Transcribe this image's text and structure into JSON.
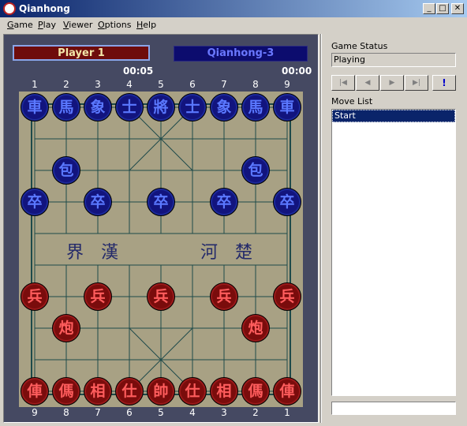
{
  "window": {
    "title": "Qianhong",
    "minimize": "_",
    "maximize": "□",
    "close": "✕"
  },
  "menu": [
    "Game",
    "Play",
    "Viewer",
    "Options",
    "Help"
  ],
  "players": {
    "red": {
      "name": "Player 1",
      "time": "00:05"
    },
    "black": {
      "name": "Qianhong-3",
      "time": "00:00"
    }
  },
  "board": {
    "top_file_labels": [
      "1",
      "2",
      "3",
      "4",
      "5",
      "6",
      "7",
      "8",
      "9"
    ],
    "bottom_file_labels": [
      "9",
      "8",
      "7",
      "6",
      "5",
      "4",
      "3",
      "2",
      "1"
    ],
    "river_text": [
      "界",
      "漢",
      "河",
      "楚"
    ],
    "pieces": [
      {
        "side": "black",
        "char": "車",
        "file": 0,
        "rank": 0
      },
      {
        "side": "black",
        "char": "馬",
        "file": 1,
        "rank": 0
      },
      {
        "side": "black",
        "char": "象",
        "file": 2,
        "rank": 0
      },
      {
        "side": "black",
        "char": "士",
        "file": 3,
        "rank": 0
      },
      {
        "side": "black",
        "char": "將",
        "file": 4,
        "rank": 0
      },
      {
        "side": "black",
        "char": "士",
        "file": 5,
        "rank": 0
      },
      {
        "side": "black",
        "char": "象",
        "file": 6,
        "rank": 0
      },
      {
        "side": "black",
        "char": "馬",
        "file": 7,
        "rank": 0
      },
      {
        "side": "black",
        "char": "車",
        "file": 8,
        "rank": 0
      },
      {
        "side": "black",
        "char": "包",
        "file": 1,
        "rank": 2
      },
      {
        "side": "black",
        "char": "包",
        "file": 7,
        "rank": 2
      },
      {
        "side": "black",
        "char": "卒",
        "file": 0,
        "rank": 3
      },
      {
        "side": "black",
        "char": "卒",
        "file": 2,
        "rank": 3
      },
      {
        "side": "black",
        "char": "卒",
        "file": 4,
        "rank": 3
      },
      {
        "side": "black",
        "char": "卒",
        "file": 6,
        "rank": 3
      },
      {
        "side": "black",
        "char": "卒",
        "file": 8,
        "rank": 3
      },
      {
        "side": "red",
        "char": "兵",
        "file": 0,
        "rank": 6
      },
      {
        "side": "red",
        "char": "兵",
        "file": 2,
        "rank": 6
      },
      {
        "side": "red",
        "char": "兵",
        "file": 4,
        "rank": 6
      },
      {
        "side": "red",
        "char": "兵",
        "file": 6,
        "rank": 6
      },
      {
        "side": "red",
        "char": "兵",
        "file": 8,
        "rank": 6
      },
      {
        "side": "red",
        "char": "炮",
        "file": 1,
        "rank": 7
      },
      {
        "side": "red",
        "char": "炮",
        "file": 7,
        "rank": 7
      },
      {
        "side": "red",
        "char": "俥",
        "file": 0,
        "rank": 9
      },
      {
        "side": "red",
        "char": "傌",
        "file": 1,
        "rank": 9
      },
      {
        "side": "red",
        "char": "相",
        "file": 2,
        "rank": 9
      },
      {
        "side": "red",
        "char": "仕",
        "file": 3,
        "rank": 9
      },
      {
        "side": "red",
        "char": "帥",
        "file": 4,
        "rank": 9
      },
      {
        "side": "red",
        "char": "仕",
        "file": 5,
        "rank": 9
      },
      {
        "side": "red",
        "char": "相",
        "file": 6,
        "rank": 9
      },
      {
        "side": "red",
        "char": "傌",
        "file": 7,
        "rank": 9
      },
      {
        "side": "red",
        "char": "俥",
        "file": 8,
        "rank": 9
      }
    ]
  },
  "side_panel": {
    "status_label": "Game Status",
    "status_value": "Playing",
    "nav_buttons": [
      {
        "icon": "first-move-icon",
        "glyph": "|◀"
      },
      {
        "icon": "previous-move-icon",
        "glyph": "◀"
      },
      {
        "icon": "next-move-icon",
        "glyph": "▶"
      },
      {
        "icon": "last-move-icon",
        "glyph": "▶|"
      },
      {
        "icon": "hint-icon",
        "glyph": "!"
      }
    ],
    "move_list_label": "Move List",
    "moves": [
      "Start"
    ],
    "selected_move": 0
  },
  "colors": {
    "panel_bg": "#454962",
    "board_bg": "#a8a184",
    "board_lines": "#1e4a4a",
    "red_piece": "#7a0c0c",
    "black_piece": "#12147e"
  }
}
